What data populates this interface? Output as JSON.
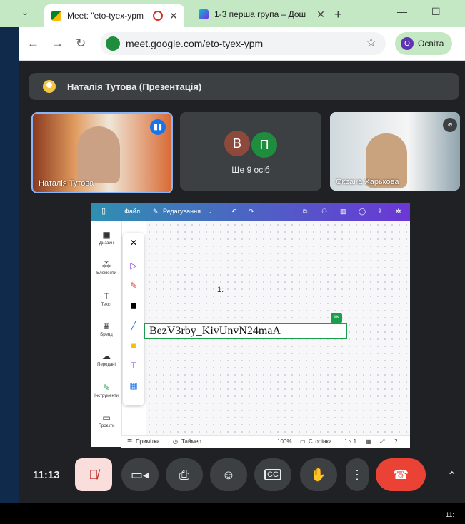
{
  "browser": {
    "tabs": [
      {
        "title": "Meet: \"eto-tyex-ypm",
        "active": true,
        "favicon": "google-meet-icon"
      },
      {
        "title": "1-3 перша група – Дош",
        "active": false,
        "favicon": "canva-icon"
      }
    ],
    "new_tab": "+",
    "window_buttons": [
      "—",
      "☐"
    ],
    "url": "meet.google.com/eto-tyex-ypm",
    "profile_initial": "O",
    "profile_name": "Освіта"
  },
  "meet": {
    "presentation_title": "Наталія Тутова (Презентація)",
    "participants": [
      {
        "name": "Наталія Тутова",
        "speaking": true
      },
      {
        "name": "Ще 9 осіб",
        "avatars": [
          "В",
          "П"
        ],
        "avatar_colors": [
          "#8d4a3c",
          "#1e8e3e"
        ]
      },
      {
        "name": "Оксана Харькова"
      }
    ],
    "clock": "11:13",
    "accent": "#8ab4f8",
    "leave_color": "#ea4335"
  },
  "canva": {
    "menu_file": "Файл",
    "menu_edit": "Редагування",
    "sidebar": [
      {
        "label": "Дизайн",
        "icon": "layout-icon"
      },
      {
        "label": "Елементи",
        "icon": "elements-icon"
      },
      {
        "label": "Текст",
        "icon": "text-icon"
      },
      {
        "label": "Бренд",
        "icon": "brand-icon"
      },
      {
        "label": "Передані",
        "icon": "upload-icon"
      },
      {
        "label": "Інструменти",
        "icon": "draw-icon"
      },
      {
        "label": "Проєкти",
        "icon": "folder-icon"
      }
    ],
    "canvas_text": "BezV3rby_KivUnvN24maA",
    "badge": "AK",
    "cursor_label": "1:",
    "bottom": {
      "notes": "Примітки",
      "timer": "Таймер",
      "zoom": "100%",
      "pages": "Сторінки",
      "page_count": "1 з 1"
    }
  },
  "taskbar": {
    "time_fragment": "11:"
  }
}
